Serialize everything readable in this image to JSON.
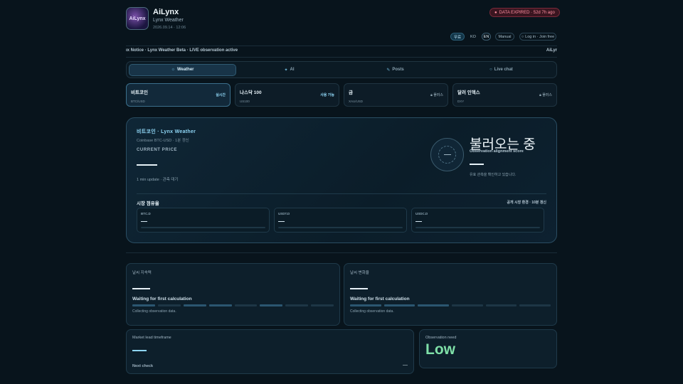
{
  "header": {
    "logo_text": "AiLynx",
    "app_name": "AiLynx",
    "subtitle": "Lynx Weather",
    "timestamp": "2026.09.14 · 12:06",
    "expired_badge": "DATA EXPIRED · 52d 7h ago"
  },
  "topbar": {
    "free_label": "무료",
    "lang_ko": "KO",
    "lang_en": "EN",
    "manual_label": "Manual",
    "login_label": "Log in · Join free"
  },
  "notice": {
    "text": "ıx Notice · Lynx Weather Beta · LIVE observation active",
    "right": "AiLyr"
  },
  "tabs": [
    {
      "label": "Weather",
      "icon": "☼"
    },
    {
      "label": "AI",
      "icon": "✦"
    },
    {
      "label": "Posts",
      "icon": "✎"
    },
    {
      "label": "Live chat",
      "icon": "○"
    }
  ],
  "assets": [
    {
      "title": "비트코인",
      "sub": "BTC/USD",
      "badge": "실시간"
    },
    {
      "title": "나스닥 100",
      "sub": "US100",
      "badge": "사용 가능"
    },
    {
      "title": "금",
      "sub": "XAU/USD",
      "badge": "플러스"
    },
    {
      "title": "달러 인덱스",
      "sub": "DXY",
      "badge": "플러스"
    }
  ],
  "hero": {
    "title": "비트코인 · Lynx Weather",
    "source": "Coinbase BTC-USD · 1분 갱신",
    "current_price_label": "CURRENT PRICE",
    "update_text": "1 min update · 관측 대기",
    "loading": "불러오는 중",
    "score_label": "Observation alignment score",
    "hold_text": "유효 관측을 확인하고 있습니다.",
    "share_title": "시장 점유율",
    "share_right": "공개 시장 환경 · 10분 갱신",
    "shares": [
      {
        "label": "BTC.D",
        "value": "—"
      },
      {
        "label": "USDT.D",
        "value": "—"
      },
      {
        "label": "USDC.D",
        "value": "—"
      }
    ]
  },
  "cards": {
    "persistence": {
      "title": "날씨 지속력",
      "status": "Waiting for first calculation",
      "note": "Collecting observation data."
    },
    "volatility": {
      "title": "날씨 변화율",
      "status": "Waiting for first calculation",
      "note": "Collecting observation data."
    },
    "lead": {
      "title": "Market lead timeframe",
      "next_label": "Next check",
      "next_value": "—"
    },
    "need": {
      "title": "Observation need",
      "value": "Low"
    }
  },
  "colors": {
    "accent": "#8fd6f5",
    "expired": "#ff8fa0",
    "low": "#7fe0a8"
  }
}
